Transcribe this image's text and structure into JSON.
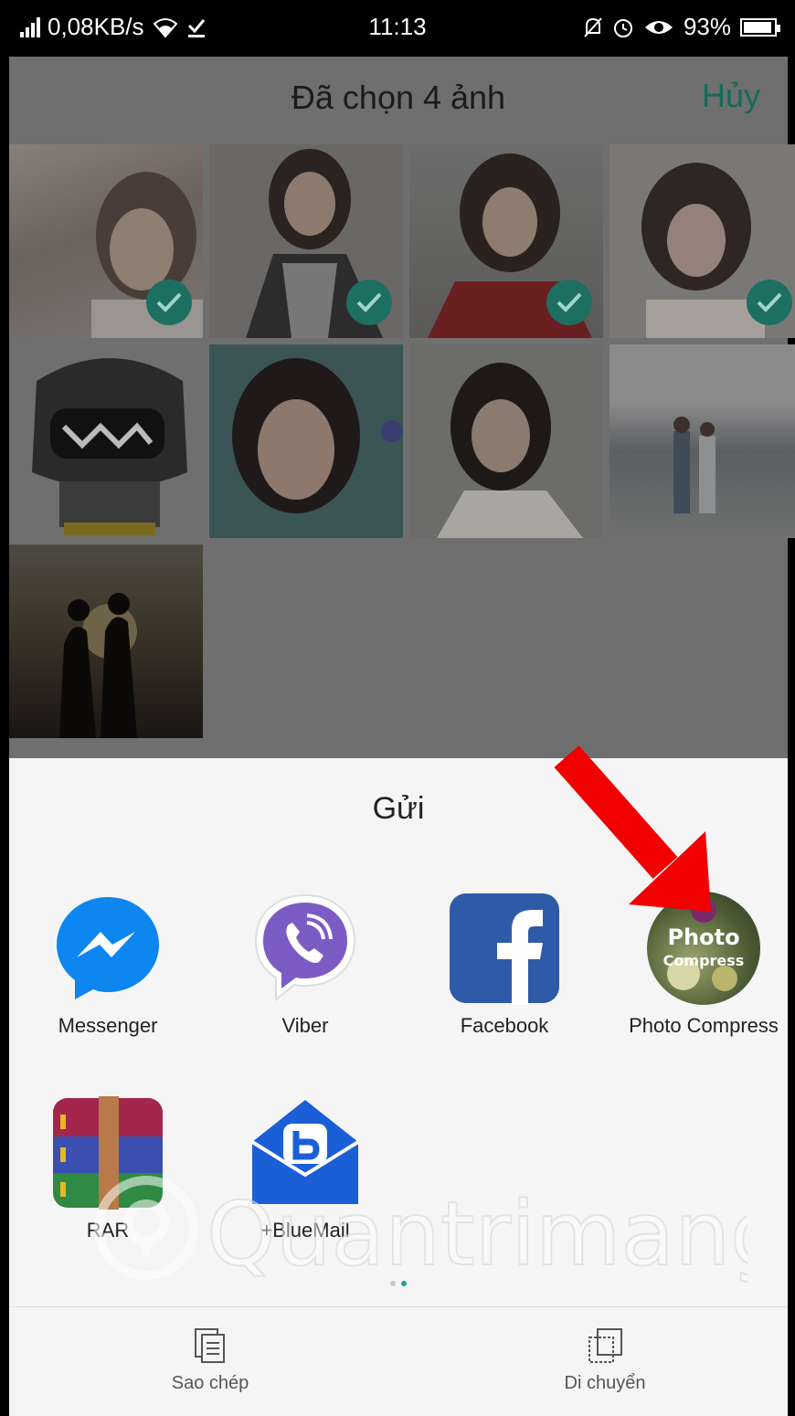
{
  "status_bar": {
    "speed": "0,08KB/s",
    "time": "11:13",
    "battery": "93%",
    "battery_level": 0.93
  },
  "header": {
    "title": "Đã chọn 4 ảnh",
    "cancel_label": "Hủy"
  },
  "gallery": {
    "photos": [
      {
        "selected": true
      },
      {
        "selected": true
      },
      {
        "selected": true
      },
      {
        "selected": true
      },
      {
        "selected": false
      },
      {
        "selected": false
      },
      {
        "selected": false
      },
      {
        "selected": false
      },
      {
        "selected": false
      }
    ]
  },
  "share_sheet": {
    "title": "Gửi",
    "apps": [
      {
        "label": "Messenger",
        "icon": "messenger-icon"
      },
      {
        "label": "Viber",
        "icon": "viber-icon"
      },
      {
        "label": "Facebook",
        "icon": "facebook-icon"
      },
      {
        "label": "Photo Compress",
        "icon": "photo-compress-icon",
        "icon_text_1": "Photo",
        "icon_text_2": "Compress"
      },
      {
        "label": "RAR",
        "icon": "rar-icon"
      },
      {
        "label": "+BlueMail",
        "icon": "bluemail-icon"
      }
    ],
    "page_indicator": {
      "pages": 2,
      "current": 2
    }
  },
  "bottom_actions": {
    "copy_label": "Sao chép",
    "move_label": "Di chuyển"
  },
  "watermark": "Quantrimang",
  "colors": {
    "accent": "#17a694",
    "arrow": "#f00000"
  }
}
